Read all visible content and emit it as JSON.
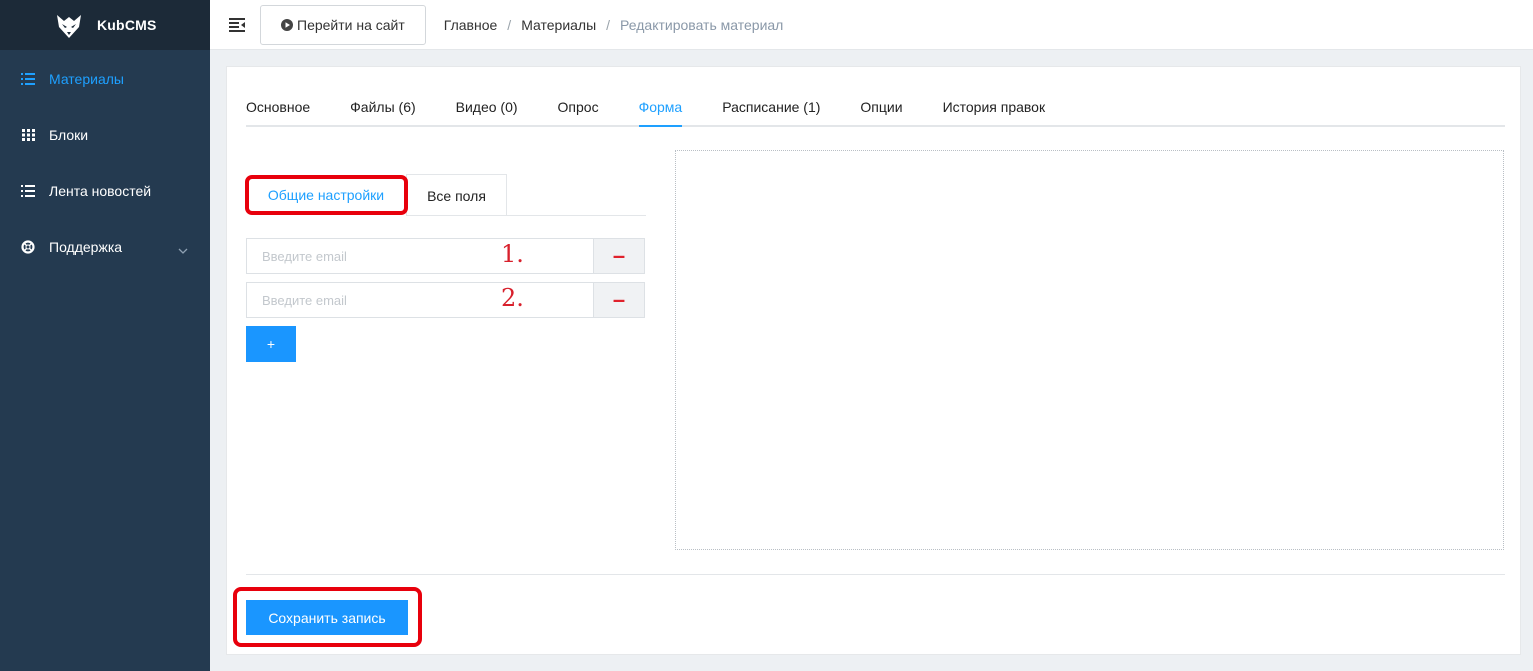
{
  "app": {
    "name": "KubCMS"
  },
  "sidebar": {
    "items": [
      {
        "label": "Материалы",
        "icon": "list-icon",
        "active": true
      },
      {
        "label": "Блоки",
        "icon": "grid-icon",
        "active": false
      },
      {
        "label": "Лента новостей",
        "icon": "list-icon",
        "active": false
      },
      {
        "label": "Поддержка",
        "icon": "lifebuoy-icon",
        "active": false,
        "expandable": true
      }
    ]
  },
  "header": {
    "site_button": "Перейти на сайт",
    "breadcrumb": [
      "Главное",
      "Материалы",
      "Редактировать материал"
    ],
    "breadcrumb_separator": "/"
  },
  "tabs": [
    {
      "label": "Основное",
      "active": false
    },
    {
      "label": "Файлы (6)",
      "active": false
    },
    {
      "label": "Видео (0)",
      "active": false
    },
    {
      "label": "Опрос",
      "active": false
    },
    {
      "label": "Форма",
      "active": true
    },
    {
      "label": "Расписание (1)",
      "active": false
    },
    {
      "label": "Опции",
      "active": false
    },
    {
      "label": "История правок",
      "active": false
    }
  ],
  "form": {
    "subtabs": [
      {
        "label": "Общие настройки",
        "active": true
      },
      {
        "label": "Все поля",
        "active": false
      }
    ],
    "email_rows": [
      {
        "placeholder": "Введите email",
        "value": "",
        "annotation": "1.",
        "remove_label": "–"
      },
      {
        "placeholder": "Введите email",
        "value": "",
        "annotation": "2.",
        "remove_label": "–"
      }
    ],
    "add_label": "+"
  },
  "footer": {
    "save_label": "Сохранить запись"
  },
  "colors": {
    "accent": "#1a96ff",
    "sidebar": "#243a50",
    "highlight": "#e8000c"
  }
}
